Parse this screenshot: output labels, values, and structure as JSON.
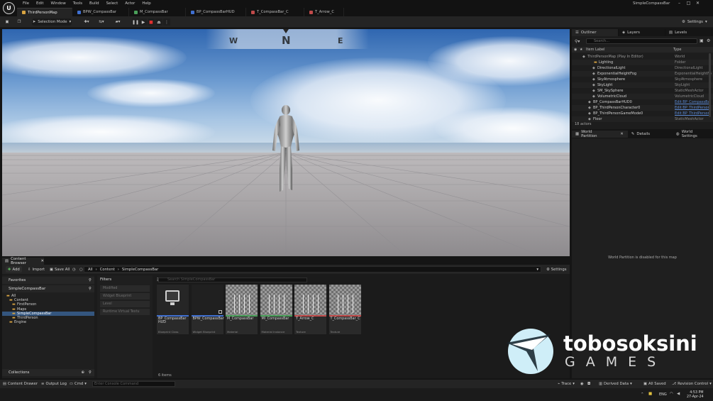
{
  "app": {
    "menu": [
      "File",
      "Edit",
      "Window",
      "Tools",
      "Build",
      "Select",
      "Actor",
      "Help"
    ],
    "window_title": "SimpleCompassBar",
    "logo_glyph": "U"
  },
  "tabs": [
    {
      "label": "ThirdPersonMap",
      "color": "#d9a441",
      "active": true
    },
    {
      "label": "BPW_CompassBar",
      "color": "#3f6fd0",
      "active": false
    },
    {
      "label": "M_CompassBar",
      "color": "#4aa05a",
      "active": false
    },
    {
      "label": "BP_CompassBarHUD",
      "color": "#3f6fd0",
      "active": false
    },
    {
      "label": "T_CompassBar_C",
      "color": "#c04a4a",
      "active": false
    },
    {
      "label": "T_Arrow_C",
      "color": "#c04a4a",
      "active": false
    }
  ],
  "toolbar": {
    "selection_mode": "Selection Mode",
    "settings": "Settings"
  },
  "viewport": {
    "compass": {
      "left": "W",
      "center": "N",
      "right": "E"
    }
  },
  "outliner": {
    "tabs": [
      "Outliner",
      "Layers",
      "Levels"
    ],
    "search_placeholder": "Search...",
    "col_label": "Item Label",
    "col_type": "Type",
    "rows": [
      {
        "label": "ThirdPersonMap (Play In Editor)",
        "type": "World",
        "link": false
      },
      {
        "label": "Lighting",
        "type": "Folder",
        "link": false
      },
      {
        "label": "DirectionalLight",
        "type": "DirectionalLight",
        "link": false
      },
      {
        "label": "ExponentialHeightFog",
        "type": "ExponentialHeightFo",
        "link": false
      },
      {
        "label": "SkyAtmosphere",
        "type": "SkyAtmosphere",
        "link": false
      },
      {
        "label": "SkyLight",
        "type": "SkyLight",
        "link": false
      },
      {
        "label": "SM_SkySphere",
        "type": "StaticMeshActor",
        "link": false
      },
      {
        "label": "VolumetricCloud",
        "type": "VolumetricCloud",
        "link": false
      },
      {
        "label": "BP_CompassBarHUD0",
        "type": "Edit BP_CompassBa",
        "link": true
      },
      {
        "label": "BP_ThirdPersonCharacter0",
        "type": "Edit BP_ThirdPerson",
        "link": true
      },
      {
        "label": "BP_ThirdPersonGameMode0",
        "type": "Edit BP_ThirdPerson",
        "link": true
      },
      {
        "label": "Floor",
        "type": "StaticMeshActor",
        "link": false
      }
    ],
    "actor_count": "18 actors"
  },
  "details": {
    "tabs": [
      "World Partition",
      "Details",
      "World Settings"
    ],
    "message": "World Partition is disabled for this map"
  },
  "content_browser": {
    "tab": "Content Browser",
    "add": "Add",
    "import": "Import",
    "save_all": "Save All",
    "breadcrumb": [
      "All",
      "Content",
      "SimpleCompassBar"
    ],
    "settings": "Settings",
    "favorites": "Favorites",
    "root": "SimpleCompassBar",
    "tree": [
      {
        "label": "All",
        "indent": 0,
        "sel": false
      },
      {
        "label": "Content",
        "indent": 1,
        "sel": false
      },
      {
        "label": "FirstPerson",
        "indent": 2,
        "sel": false
      },
      {
        "label": "Maps",
        "indent": 2,
        "sel": false
      },
      {
        "label": "SimpleCompassBar",
        "indent": 2,
        "sel": true
      },
      {
        "label": "ThirdPerson",
        "indent": 2,
        "sel": false
      },
      {
        "label": "Engine",
        "indent": 1,
        "sel": false
      }
    ],
    "filters_title": "Filters",
    "filters": [
      "Modified",
      "Widget Blueprint",
      "Level",
      "Runtime Virtual Textu"
    ],
    "search_placeholder": "Search SimpleCompassBar",
    "assets": [
      {
        "name": "BP_CompassBar HUD",
        "type": "Blueprint Class",
        "stripe": "#3f6fd0",
        "thumb": "hud"
      },
      {
        "name": "BPW_CompassBar",
        "type": "Widget Blueprint",
        "stripe": "#3f6fd0",
        "thumb": "dark"
      },
      {
        "name": "M_CompassBar",
        "type": "Material",
        "stripe": "#4aa05a",
        "thumb": "checker"
      },
      {
        "name": "MI_CompassBar",
        "type": "Material Instance",
        "stripe": "#4aa05a",
        "thumb": "checker"
      },
      {
        "name": "T_Arrow_C",
        "type": "Texture",
        "stripe": "#c04a4a",
        "thumb": "checker"
      },
      {
        "name": "T_CompassBar_C",
        "type": "Texture",
        "stripe": "#c04a4a",
        "thumb": "checker"
      }
    ],
    "item_count": "6 items",
    "collections": "Collections"
  },
  "statusbar": {
    "drawer": "Content Drawer",
    "output": "Output Log",
    "cmd": "Cmd",
    "console_placeholder": "Enter Console Command",
    "trace": "Trace",
    "derived": "Derived Data",
    "saved": "All Saved",
    "revision": "Revision Control"
  },
  "taskbar": {
    "lang": "ENG",
    "time": "4:53 PM",
    "date": "27-Apr-24"
  },
  "watermark": {
    "name": "tobosoksini",
    "sub": "GAMES"
  }
}
